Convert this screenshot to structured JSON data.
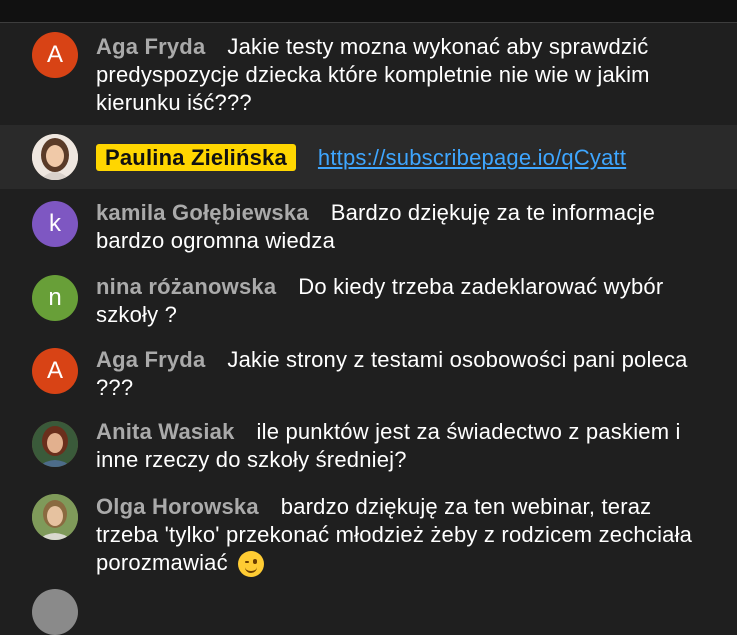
{
  "messages": [
    {
      "author": "Aga Fryda",
      "text": "Jakie testy mozna wykonać aby sprawdzić predyspozycje dziecka które kompletnie nie wie w jakim kierunku iść???",
      "avatar_letter": "A",
      "avatar_color": "#d84315"
    },
    {
      "author": "Paulina Zielińska",
      "text": "https://subscribepage.io/qCyatt",
      "avatar_letter": "",
      "avatar_color": "#c7a58a",
      "is_owner": true
    },
    {
      "author": "kamila Gołębiewska",
      "text": "Bardzo dziękuję za te informacje bardzo ogromna wiedza",
      "avatar_letter": "k",
      "avatar_color": "#7e57c2"
    },
    {
      "author": "nina różanowska",
      "text": "Do kiedy trzeba zadeklarować wybór szkoły ?",
      "avatar_letter": "n",
      "avatar_color": "#689f38"
    },
    {
      "author": "Aga Fryda",
      "text": "Jakie strony z testami osobowości pani poleca ???",
      "avatar_letter": "A",
      "avatar_color": "#d84315"
    },
    {
      "author": "Anita Wasiak",
      "text": "ile punktów jest za świadectwo z paskiem i inne rzeczy do szkoły średniej?",
      "avatar_letter": "",
      "avatar_color": "#7a4a30"
    },
    {
      "author": "Olga Horowska",
      "text": "bardzo dziękuję za ten webinar, teraz trzeba 'tylko' przekonać młodzież żeby z rodzicem zechciała porozmawiać",
      "avatar_letter": "",
      "avatar_color": "#6f8a4a",
      "emoji": "winking-face"
    }
  ],
  "colors": {
    "background": "#1f1f1f",
    "author": "#aaaaaa",
    "owner_badge": "#ffd600",
    "link": "#3ea6ff"
  }
}
